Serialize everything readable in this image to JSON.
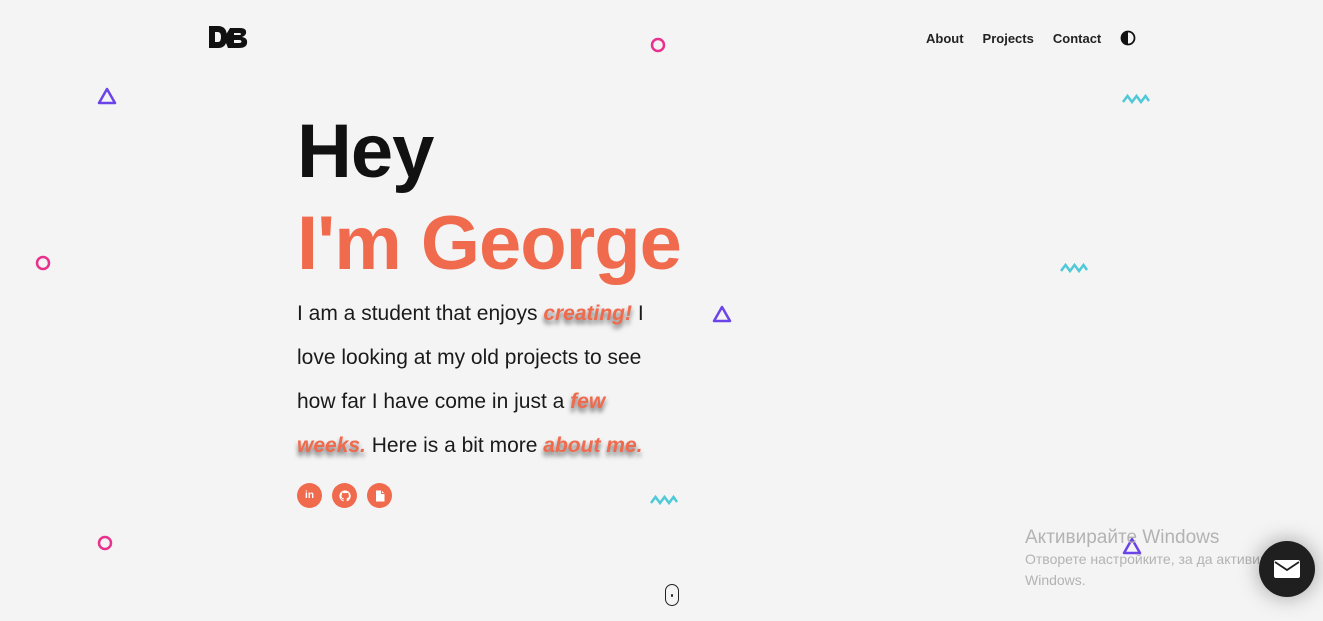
{
  "header": {
    "logo_text": "DB",
    "nav": [
      {
        "label": "About"
      },
      {
        "label": "Projects"
      },
      {
        "label": "Contact"
      }
    ],
    "theme_toggle_icon": "contrast-icon"
  },
  "hero": {
    "greeting": "Hey",
    "name": "I'm George",
    "intro": {
      "part1": "I am a student that enjoys ",
      "hl1": "creating!",
      "part2": " I love looking at my old projects to see how far I have come in just a ",
      "hl2": "few weeks.",
      "part3": " Here is a bit more ",
      "hl3": "about me."
    }
  },
  "socials": [
    {
      "icon": "linkedin-icon",
      "glyph": "in"
    },
    {
      "icon": "github-icon"
    },
    {
      "icon": "document-icon"
    }
  ],
  "windows_watermark": {
    "title": "Активирайте Windows",
    "subtitle": "Отворете настройките, за да активирате Windows."
  },
  "colors": {
    "accent": "#f06a4d",
    "background": "#f4f4f4",
    "deco_pink": "#e8318c",
    "deco_purple": "#6a44e8",
    "deco_teal": "#4fc9d8"
  }
}
